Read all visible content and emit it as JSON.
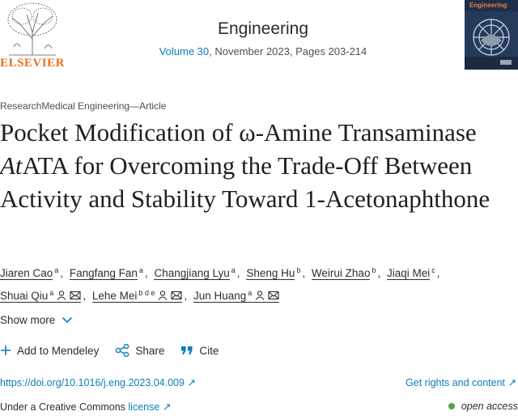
{
  "header": {
    "publisher": "ELSEVIER",
    "journal_title": "Engineering",
    "volume_link": "Volume 30",
    "issue_rest": ", November 2023, Pages 203-214",
    "cover_title": "Engineering"
  },
  "article": {
    "type": "ResearchMedical Engineering—Article",
    "title_part1": "Pocket Modification of ω-Amine Transaminase ",
    "title_italic": "At",
    "title_part2": "ATA for Overcoming the Trade-Off Between Activity and Stability Toward 1-Acetonaphthone"
  },
  "authors": [
    {
      "name": "Jiaren Cao",
      "sup": "a"
    },
    {
      "name": "Fangfang Fan",
      "sup": "a"
    },
    {
      "name": "Changjiang Lyu",
      "sup": "a"
    },
    {
      "name": "Sheng Hu",
      "sup": "b"
    },
    {
      "name": "Weirui Zhao",
      "sup": "b"
    },
    {
      "name": "Jiaqi Mei",
      "sup": "c"
    },
    {
      "name": "Shuai Qiu",
      "sup": "a"
    },
    {
      "name": "Lehe Mei",
      "sup": "b d e"
    },
    {
      "name": "Jun Huang",
      "sup": "a"
    }
  ],
  "show_more": "Show more",
  "actions": {
    "mendeley": "Add to Mendeley",
    "share": "Share",
    "cite": "Cite"
  },
  "links": {
    "doi": "https://doi.org/10.1016/j.eng.2023.04.009",
    "rights": "Get rights and content"
  },
  "license": {
    "prefix": "Under a Creative Commons ",
    "link": "license",
    "open_access": "open access"
  },
  "colors": {
    "link": "#0c7dbb",
    "publisher_orange": "#e9711c",
    "open_access_green": "#57a04b"
  }
}
